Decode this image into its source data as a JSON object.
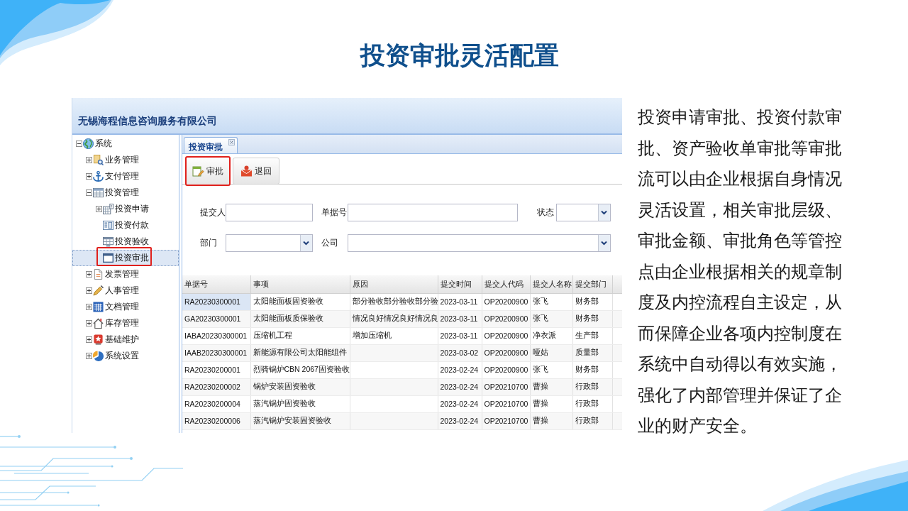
{
  "title": "投资审批灵活配置",
  "app": {
    "company": "无锡海程信息咨询服务有限公司",
    "sidebar": {
      "tree": [
        {
          "label": "系统",
          "kind": "branch",
          "expanded": true,
          "selected": false,
          "highlighted": false,
          "children": [
            {
              "label": "业务管理",
              "kind": "branch",
              "expanded": false,
              "selected": false,
              "highlighted": false
            },
            {
              "label": "支付管理",
              "kind": "branch",
              "expanded": false,
              "selected": false,
              "highlighted": false
            },
            {
              "label": "投资管理",
              "kind": "branch",
              "expanded": true,
              "selected": false,
              "highlighted": false,
              "children": [
                {
                  "label": "投资申请",
                  "kind": "branch",
                  "expanded": false,
                  "selected": false,
                  "highlighted": false
                },
                {
                  "label": "投资付款",
                  "kind": "leaf",
                  "selected": false,
                  "highlighted": false
                },
                {
                  "label": "投资验收",
                  "kind": "leaf",
                  "selected": false,
                  "highlighted": false
                },
                {
                  "label": "投资审批",
                  "kind": "leaf",
                  "selected": true,
                  "highlighted": true
                }
              ]
            },
            {
              "label": "发票管理",
              "kind": "branch",
              "expanded": false,
              "selected": false,
              "highlighted": false
            },
            {
              "label": "人事管理",
              "kind": "branch",
              "expanded": false,
              "selected": false,
              "highlighted": false
            },
            {
              "label": "文档管理",
              "kind": "branch",
              "expanded": false,
              "selected": false,
              "highlighted": false
            },
            {
              "label": "库存管理",
              "kind": "branch",
              "expanded": false,
              "selected": false,
              "highlighted": false
            },
            {
              "label": "基础维护",
              "kind": "branch",
              "expanded": false,
              "selected": false,
              "highlighted": false
            },
            {
              "label": "系统设置",
              "kind": "branch",
              "expanded": false,
              "selected": false,
              "highlighted": false
            }
          ]
        }
      ]
    },
    "tabs": [
      {
        "label": "投资审批",
        "selected": true
      }
    ],
    "toolbar": [
      {
        "label": "审批",
        "highlighted": true
      },
      {
        "label": "退回",
        "highlighted": false
      }
    ],
    "form": {
      "rows": [
        [
          {
            "label": "提交人",
            "kind": "text"
          },
          {
            "label": "单据号",
            "kind": "text"
          },
          {
            "label": "状态",
            "kind": "select"
          }
        ],
        [
          {
            "label": "部门",
            "kind": "select"
          },
          {
            "label": "公司",
            "kind": "select"
          }
        ]
      ]
    },
    "table": {
      "columns": [
        "单据号",
        "事项",
        "原因",
        "提交时间",
        "提交人代码",
        "提交人名称",
        "提交部门"
      ],
      "rows": [
        {
          "selected": true,
          "doc_no": "RA20230300001",
          "matter": "太阳能面板固资验收",
          "reason": "部分验收部分验收部分验",
          "submit_date": "2023-03-11",
          "submitter_code": "OP20200900",
          "submitter_name": "张飞",
          "department": "财务部"
        },
        {
          "selected": false,
          "doc_no": "GA20230300001",
          "matter": "太阳能面板质保验收",
          "reason": "情况良好情况良好情况良",
          "submit_date": "2023-03-11",
          "submitter_code": "OP20200900",
          "submitter_name": "张飞",
          "department": "财务部"
        },
        {
          "selected": false,
          "doc_no": "IABA20230300001",
          "matter": "压缩机工程",
          "reason": "增加压缩机",
          "submit_date": "2023-03-11",
          "submitter_code": "OP20200900",
          "submitter_name": "净衣派",
          "department": "生产部"
        },
        {
          "selected": false,
          "doc_no": "IAAB20230300001",
          "matter": "新能源有限公司太阳能组件",
          "submit_date": "2023-03-02",
          "submitter_code": "OP20200900",
          "submitter_name": "哑姑",
          "department": "质量部"
        },
        {
          "selected": false,
          "doc_no": "RA20230200001",
          "matter": "烈骑锅炉CBN 2067固资验收",
          "submit_date": "2023-02-24",
          "submitter_code": "OP20200900",
          "submitter_name": "张飞",
          "department": "财务部"
        },
        {
          "selected": false,
          "doc_no": "RA20230200002",
          "matter": "锅炉安装固资验收",
          "submit_date": "2023-02-24",
          "submitter_code": "OP20210700",
          "submitter_name": "曹操",
          "department": "行政部"
        },
        {
          "selected": false,
          "doc_no": "RA20230200004",
          "matter": "蒸汽锅炉固资验收",
          "submit_date": "2023-02-24",
          "submitter_code": "OP20210700",
          "submitter_name": "曹操",
          "department": "行政部"
        },
        {
          "selected": false,
          "doc_no": "RA20230200006",
          "matter": "蒸汽锅炉安装固资验收",
          "submit_date": "2023-02-24",
          "submitter_code": "OP20210700",
          "submitter_name": "曹操",
          "department": "行政部"
        }
      ]
    }
  },
  "description": "投资申请审批、投资付款审批、资产验收单审批等审批流可以由企业根据自身情况灵活设置，相关审批层级、审批金额、审批角色等管控点由企业根据相关的规章制度及内控流程自主设定，从而保障企业各项内控制度在系统中自动得以有效实施，强化了内部管理并保证了企业的财产安全。"
}
